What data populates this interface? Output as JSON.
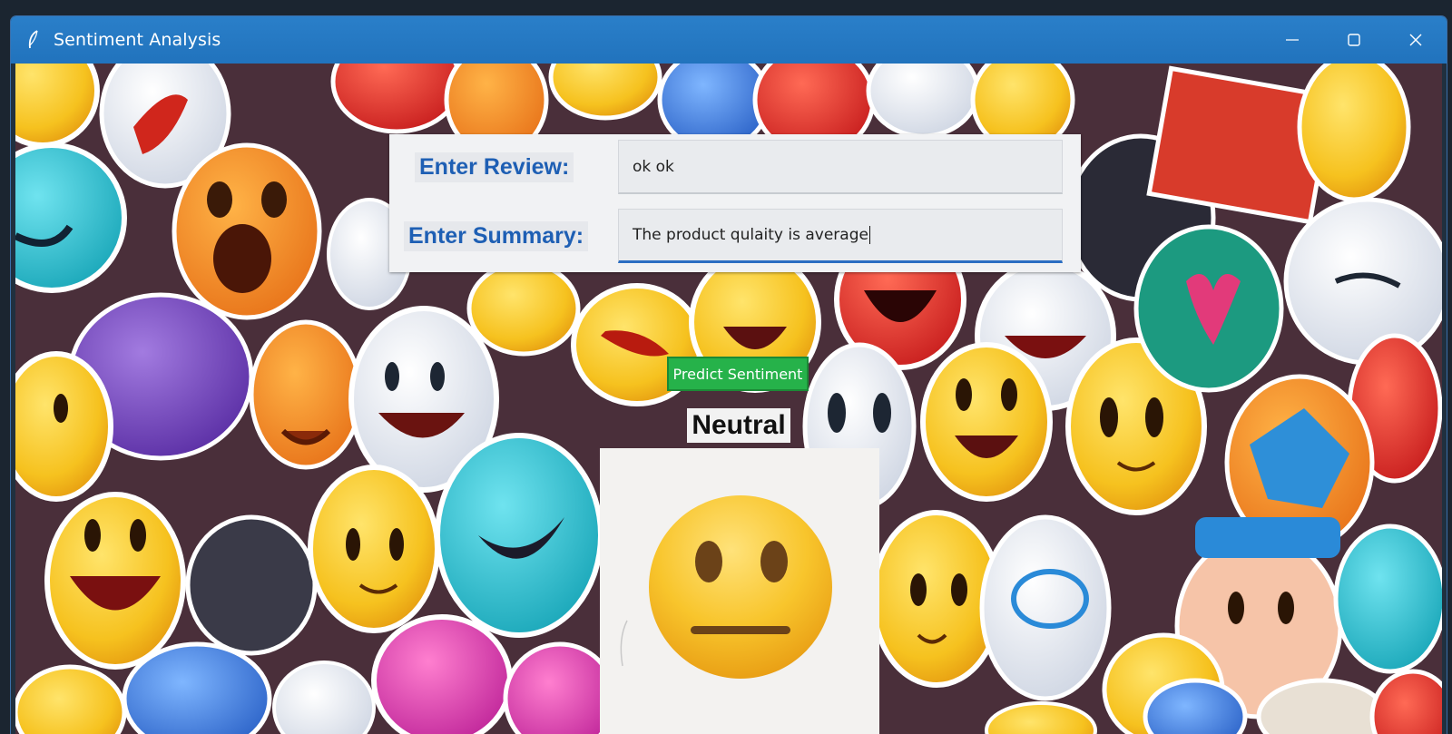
{
  "window": {
    "title": "Sentiment Analysis",
    "controls": [
      "minimize",
      "maximize",
      "close"
    ]
  },
  "form": {
    "review_label": "Enter Review:",
    "review_value": "ok ok",
    "summary_label": "Enter Summary:",
    "summary_value": "The product qulaity is average"
  },
  "predict_button": {
    "label": "Predict Sentiment"
  },
  "result": {
    "label": "Neutral",
    "icon": "neutral-face-emoji-icon"
  },
  "background": {
    "description_icon": "emoji-collage-background"
  },
  "colors": {
    "titlebar": "#2173bd",
    "label_text": "#1e5fb4",
    "button": "#26b24a",
    "input_focus_underline": "#2b6ec2"
  }
}
